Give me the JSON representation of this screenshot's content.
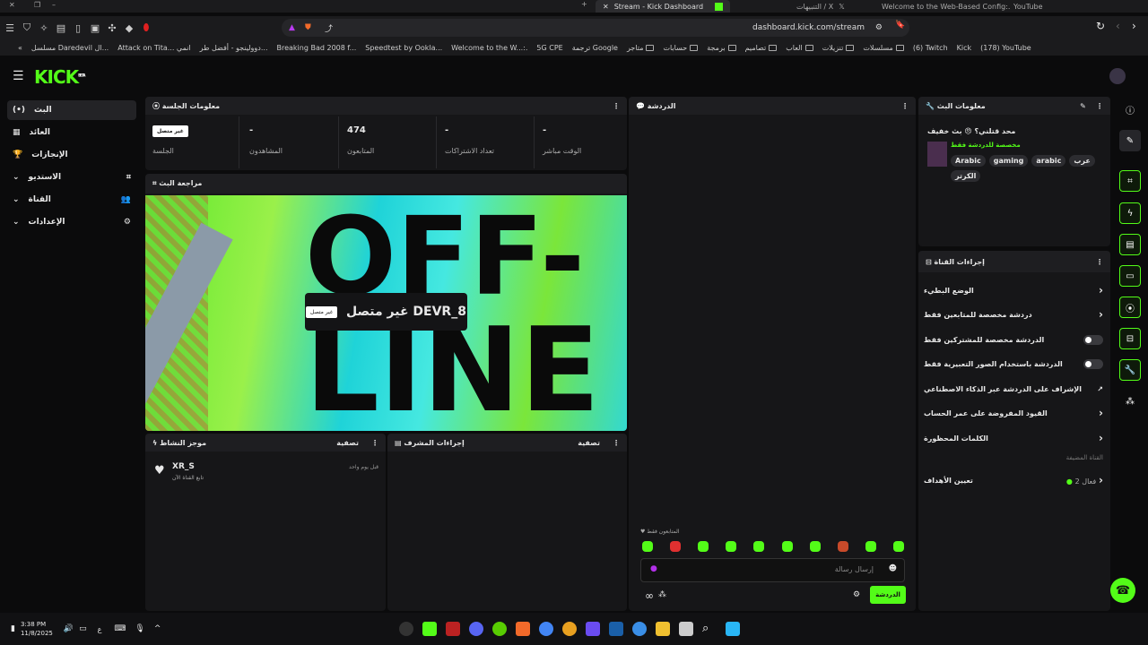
{
  "browser": {
    "tabs": [
      {
        "label": "Stream - Kick Dashboard",
        "active": true
      },
      {
        "label": "التنبيهات / X"
      },
      {
        "label": "Welcome to the Web-Based Config:."
      },
      {
        "label": "YouTube"
      }
    ],
    "url": "dashboard.kick.com/stream",
    "bookmarks": [
      "مسلسل Daredevil ال...",
      "Attack on Tita... انمي",
      "دوولينجو - أفضل طر...",
      "Breaking Bad 2008 f...",
      "Speedtest by Ookla...",
      "Welcome to the W...:.",
      "5G CPE",
      "ترجمة Google",
      "متاجر",
      "حسابات",
      "برمجة",
      "تصاميم",
      "العاب",
      "تنزيلات",
      "مسلسلات",
      "(6) Twitch",
      "Kick",
      "(178) YouTube"
    ]
  },
  "brand": {
    "logo": "KICK",
    "beta": "BETA",
    "accent": "#53fc18"
  },
  "sidebar": {
    "items": [
      {
        "label": "البث",
        "icon": "broadcast-icon",
        "active": true
      },
      {
        "label": "العائد",
        "icon": "chart-icon"
      },
      {
        "label": "الإنجازات",
        "icon": "trophy-icon"
      },
      {
        "label": "الاستديو",
        "icon": "studio-icon",
        "expandable": true
      },
      {
        "label": "القناة",
        "icon": "users-icon",
        "expandable": true
      },
      {
        "label": "الإعدادات",
        "icon": "gear-icon",
        "expandable": true
      }
    ]
  },
  "session": {
    "title": "معلومات الجلسة",
    "stats": [
      {
        "value": "غير متصل",
        "label": "الجلسة"
      },
      {
        "value": "-",
        "label": "المشاهدون"
      },
      {
        "value": "474",
        "label": "المتابعون"
      },
      {
        "value": "-",
        "label": "تعداد الاشتراكات"
      },
      {
        "value": "-",
        "label": "الوقت مباشر"
      }
    ]
  },
  "preview": {
    "title": "مراجعة البث",
    "overlay_name": "غير متصل DEVR_8",
    "overlay_badge": "غير متصل",
    "image_text_1": "OFF-",
    "image_text_2": "LINE"
  },
  "activity": {
    "title": "موجز النشاط",
    "filter": "تصفية",
    "items": [
      {
        "user": "XR_S",
        "action": "تابع القناة الآن",
        "time": "قبل يوم واحد"
      }
    ]
  },
  "mod_actions": {
    "title": "إجراءات المشرف",
    "filter": "تصفية"
  },
  "chat": {
    "title": "الدردشة",
    "followers_only": "المتابعون فقط",
    "placeholder": "إرسال رسالة",
    "send": "الدردشة"
  },
  "stream_info": {
    "title": "معلومات البث",
    "stream_title": "محد قتلني؟ 😠 بث خفيف",
    "category": "مخصصة للدردشة فقط",
    "tags": [
      "Arabic",
      "gaming",
      "arabic",
      "عرب",
      "الكرتر"
    ]
  },
  "channel_actions": {
    "title": "إجراءات القناة",
    "rows": [
      {
        "label": "الوضع البطيء",
        "control": "chevron"
      },
      {
        "label": "دردشة مخصصة للمتابعين فقط",
        "control": "chevron"
      },
      {
        "label": "الدردشة مخصصة للمشتركين فقط",
        "control": "toggle",
        "on": false
      },
      {
        "label": "الدردشة باستخدام الصور التعبيرية فقط",
        "control": "toggle",
        "on": false
      },
      {
        "label": "الإشراف على الدردشة عبر الذكاء الاصطناعي",
        "control": "external"
      },
      {
        "label": "القيود المفروضة على عمر الحساب",
        "control": "chevron"
      },
      {
        "label": "الكلمات المحظورة",
        "control": "chevron"
      }
    ],
    "section": "القناة المضيفة",
    "goals": {
      "label": "تعيين الأهداف",
      "status": "فعال 2"
    }
  },
  "taskbar": {
    "time": "3:38 PM",
    "date": "11/8/2025",
    "lang": "ع"
  }
}
